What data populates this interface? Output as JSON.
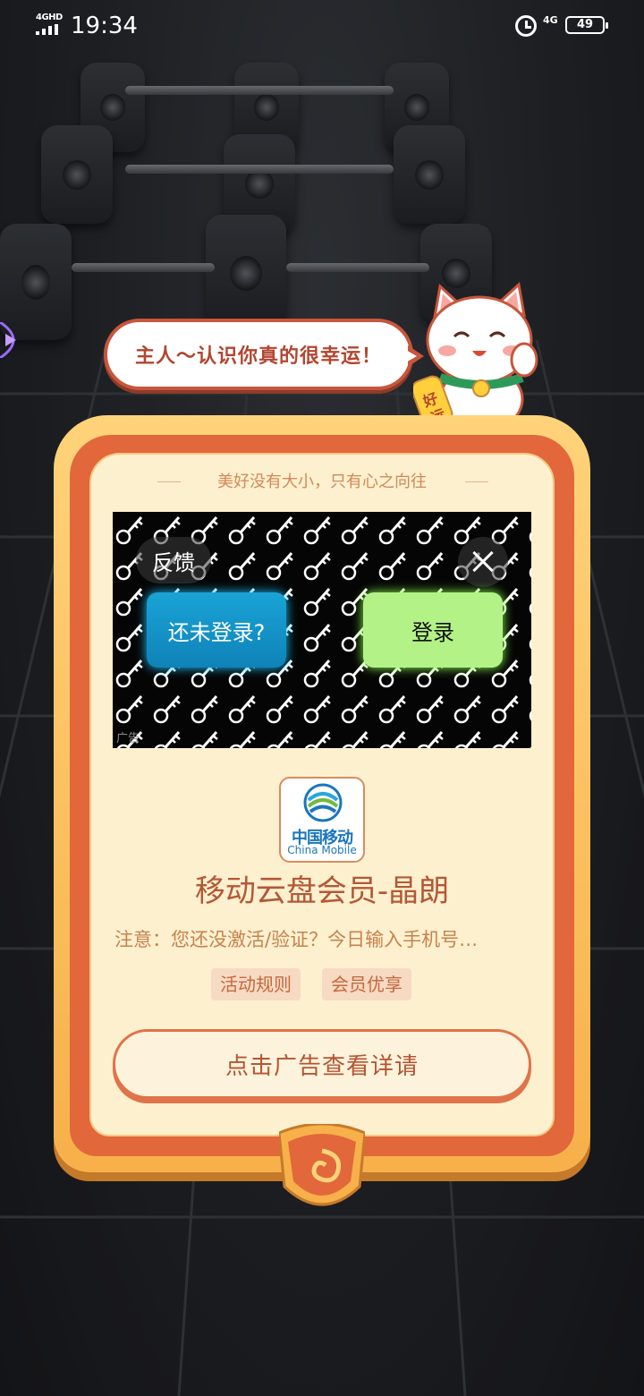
{
  "status_bar": {
    "network_label": "4GHD",
    "time": "19:34",
    "network_type": "4G",
    "battery": "49"
  },
  "bubble": {
    "text": "主人～认识你真的很幸运！"
  },
  "lucky_cat": {
    "tag_text": "好运"
  },
  "card": {
    "motto": "美好没有大小，只有心之向往",
    "ad": {
      "feedback_label": "反馈",
      "not_logged_in_label": "还未登录?",
      "login_label": "登录",
      "ad_badge": "广告"
    },
    "logo": {
      "cn": "中国移动",
      "en": "China Mobile"
    },
    "app_name": "移动云盘会员-晶朗",
    "description": "注意：您还没激活/验证？今日输入手机号…",
    "tags": [
      "活动规则",
      "会员优享"
    ],
    "cta_label": "点击广告查看详请"
  },
  "colors": {
    "card_ring": "#e2673b",
    "card_bg": "#fdf0cf",
    "accent_text": "#b25937",
    "login_green": "#b3f287",
    "not_logged_blue": "#1aa3d6"
  }
}
